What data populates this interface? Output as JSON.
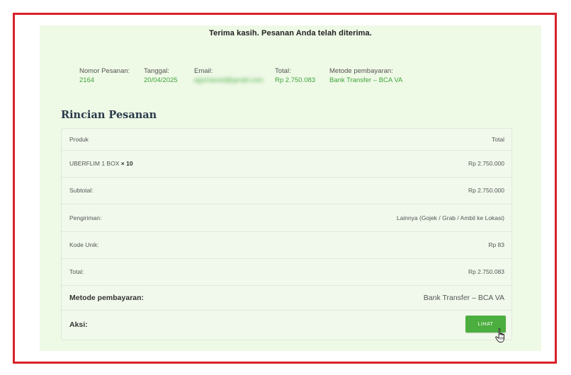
{
  "thanks_message": "Terima kasih. Pesanan Anda telah diterima.",
  "overview": [
    {
      "label": "Nomor Pesanan:",
      "value": "2164"
    },
    {
      "label": "Tanggal:",
      "value": "20/04/2025"
    },
    {
      "label": "Email:",
      "value": "agsmanod@gmail.com",
      "obscured": true
    },
    {
      "label": "Total:",
      "value": "Rp 2.750.083"
    },
    {
      "label": "Metode pembayaran:",
      "value": "Bank Transfer – BCA VA"
    }
  ],
  "details": {
    "heading": "Rincian Pesanan",
    "header": {
      "product": "Produk",
      "total": "Total"
    },
    "item": {
      "name": "UBERFLIM 1 BOX",
      "qty": "× 10",
      "price": "Rp 2.750.000"
    },
    "subtotal": {
      "label": "Subtotal:",
      "value": "Rp 2.750.000"
    },
    "shipping": {
      "label": "Pengiriman:",
      "value": "Lainnya (Gojek / Grab / Ambil ke Lokasi)"
    },
    "unique_code": {
      "label": "Kode Unik:",
      "value": "Rp 83"
    },
    "total": {
      "label": "Total:",
      "value": "Rp 2.750.083"
    },
    "payment": {
      "label": "Metode pembayaran:",
      "value": "Bank Transfer – BCA VA"
    },
    "action": {
      "label": "Aksi:",
      "button": "LIHAT"
    }
  },
  "colors": {
    "frame_border": "#d8212a",
    "panel_bg": "#eef9e6",
    "accent_green": "#4cae3f",
    "value_green": "#3fa53a"
  },
  "icons": [
    "hand-pointer-cursor-icon"
  ]
}
